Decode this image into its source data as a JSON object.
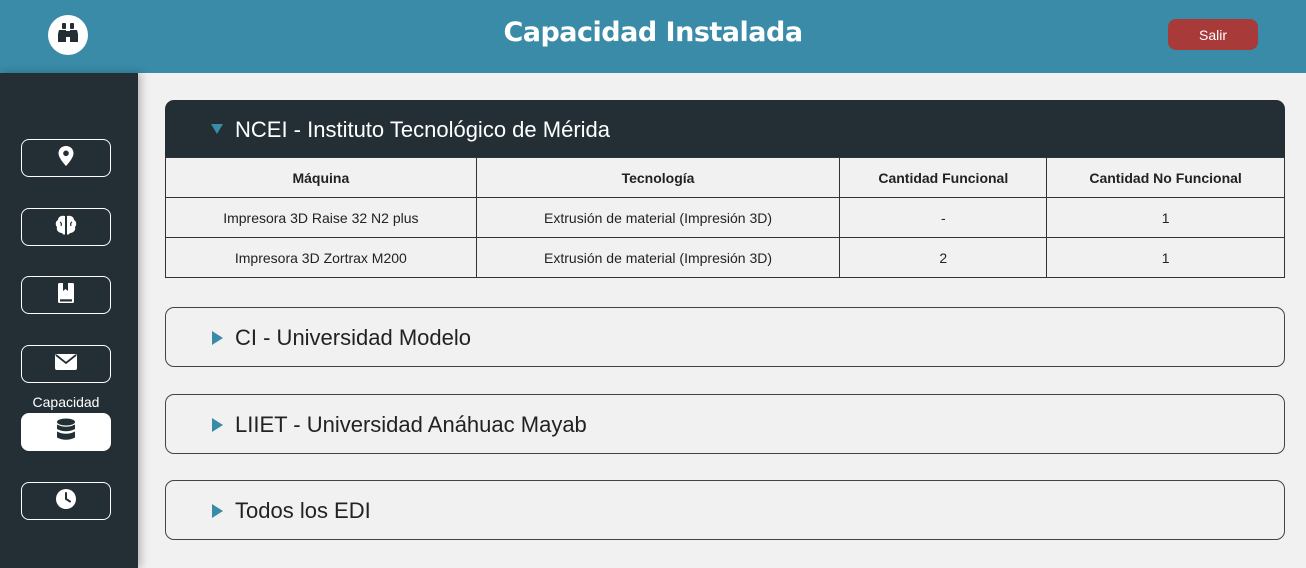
{
  "header": {
    "title": "Capacidad Instalada",
    "logout_label": "Salir",
    "logo_icon": "binoculars-icon",
    "colors": {
      "header_bg": "#3a8ba8",
      "logout_bg": "#a83a3a"
    }
  },
  "sidebar": {
    "items": [
      {
        "icon": "location-pin-icon"
      },
      {
        "icon": "brain-icon"
      },
      {
        "icon": "book-bookmark-icon"
      },
      {
        "icon": "envelope-icon"
      },
      {
        "icon": "database-icon",
        "label": "Capacidad",
        "active": true
      },
      {
        "icon": "clock-icon"
      }
    ],
    "colors": {
      "bg": "#232e35"
    }
  },
  "panels": [
    {
      "title": "NCEI - Instituto Tecnológico de Mérida",
      "expanded": true,
      "table": {
        "headers": [
          "Máquina",
          "Tecnología",
          "Cantidad Funcional",
          "Cantidad No Funcional"
        ],
        "rows": [
          [
            "Impresora 3D Raise 32 N2 plus",
            "Extrusión de material (Impresión 3D)",
            "-",
            "1"
          ],
          [
            "Impresora 3D Zortrax M200",
            "Extrusión de material (Impresión 3D)",
            "2",
            "1"
          ]
        ]
      }
    },
    {
      "title": "CI - Universidad Modelo",
      "expanded": false
    },
    {
      "title": "LIIET - Universidad Anáhuac Mayab",
      "expanded": false
    },
    {
      "title": "Todos los EDI",
      "expanded": false
    }
  ]
}
